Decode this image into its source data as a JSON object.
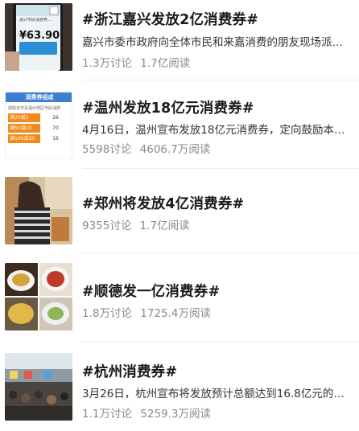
{
  "topics": [
    {
      "title": "#浙江嘉兴发放2亿消费券#",
      "desc": "嘉兴市委市政府向全体市民和来嘉消费的朋友现场派…",
      "discussions": "1.3万讨论",
      "reads": "1.7亿阅读",
      "thumb": {
        "phone_text": "嘉兴市民消费券…",
        "amount": "¥63.90"
      }
    },
    {
      "title": "#温州发放18亿元消费券#",
      "desc": "4月16日，温州宣布发放18亿元消费券，定向鼓励本…",
      "discussions": "5598讨论",
      "reads": "4606.7万阅读",
      "thumb": {
        "header": "消费券组成",
        "subtitle": "获取本市及温州地区市民消费",
        "rows": [
          [
            "满20减3",
            "26"
          ],
          [
            "满50减10",
            "70"
          ],
          [
            "满100减30",
            "16"
          ]
        ]
      }
    },
    {
      "title": "#郑州将发放4亿消费券#",
      "desc": "",
      "discussions": "9355讨论",
      "reads": "1.7亿阅读"
    },
    {
      "title": "#顺德发一亿消费券#",
      "desc": "",
      "discussions": "1.8万讨论",
      "reads": "1725.4万阅读"
    },
    {
      "title": "#杭州消费券#",
      "desc": "3月26日，杭州宣布将发放预计总额达到16.8亿元的…",
      "discussions": "1.1万讨论",
      "reads": "5259.3万阅读"
    }
  ],
  "colors": {
    "title": "#1a1a1a",
    "meta": "#8a8a8a",
    "accent": "#f08a1c"
  }
}
